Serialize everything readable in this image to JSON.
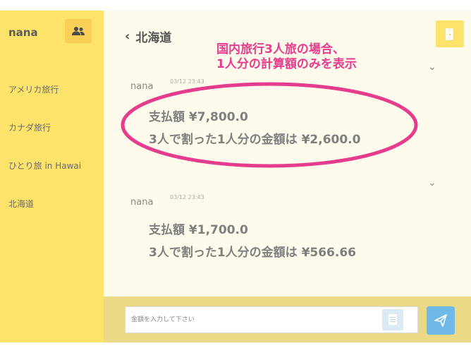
{
  "sidebar": {
    "username": "nana",
    "items": [
      {
        "label": "アメリカ旅行"
      },
      {
        "label": "カナダ旅行"
      },
      {
        "label": "ひとり旅 in Hawai"
      },
      {
        "label": "北海道"
      }
    ]
  },
  "header": {
    "back_chevron": "‹",
    "title": "北海道"
  },
  "annotation": {
    "line1": "国内旅行3人旅の場合、",
    "line2": "1人分の計算額のみを表示"
  },
  "messages": [
    {
      "user": "nana",
      "time": "03/12 23:43",
      "line1": "支払額 ¥7,800.0",
      "line2": "3人で割った1人分の金額は ¥2,600.0",
      "chevron": "⌄"
    },
    {
      "user": "nana",
      "time": "03/12 23:43",
      "line1": "支払額 ¥1,700.0",
      "line2": "3人で割った1人分の金額は ¥566.66",
      "chevron": "⌄"
    }
  ],
  "footer": {
    "amount_placeholder": "金額を入力して下さい",
    "amount_value": ""
  },
  "colors": {
    "sidebar_bg": "#fde36a",
    "main_bg": "#fffbec",
    "footer_bg": "#ebd988",
    "annotation": "#e63c8d",
    "send_button": "#6fb9e8"
  },
  "icons": {
    "people": "people-icon",
    "exit": "door-exit-icon",
    "receipt": "receipt-icon",
    "send": "paper-plane-icon"
  }
}
